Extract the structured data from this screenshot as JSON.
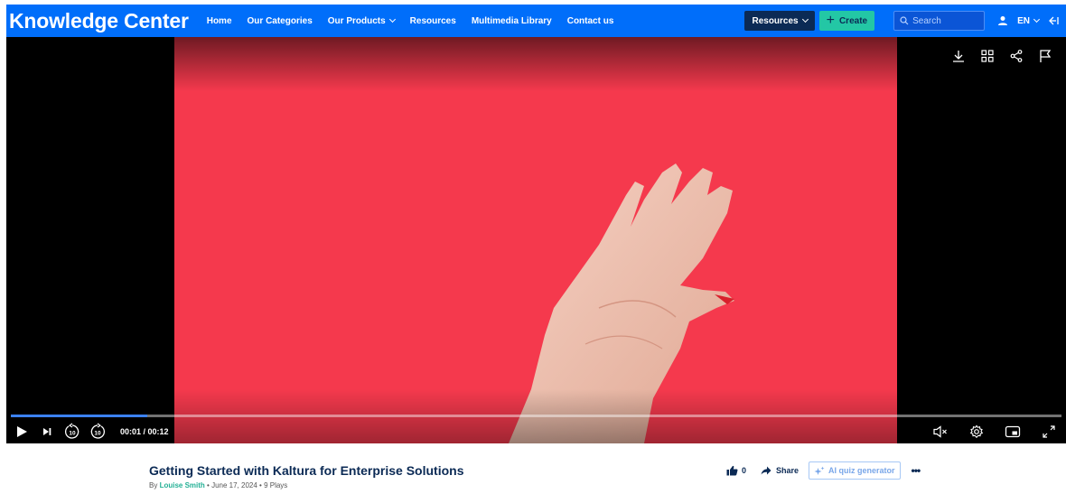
{
  "header": {
    "brand": "Knowledge Center",
    "nav": [
      {
        "label": "Home",
        "has_dropdown": false
      },
      {
        "label": "Our Categories",
        "has_dropdown": false
      },
      {
        "label": "Our Products",
        "has_dropdown": true
      },
      {
        "label": "Resources",
        "has_dropdown": false
      },
      {
        "label": "Multimedia Library",
        "has_dropdown": false
      },
      {
        "label": "Contact us",
        "has_dropdown": false
      }
    ],
    "resources_button": "Resources",
    "create_button": "Create",
    "search_placeholder": "Search",
    "language": "EN",
    "colors": {
      "bar": "#006efa",
      "resources_bg": "#0b2a55",
      "create_bg": "#23c7a5"
    }
  },
  "player": {
    "time_display": "00:01 / 00:12",
    "progress": 0.13,
    "video_bg": "#f5394d",
    "top_icons": [
      "download-icon",
      "grid-icon",
      "share-icon",
      "flag-icon"
    ],
    "bottom_left_icons": [
      "play-icon",
      "next-icon",
      "rewind-10-icon",
      "forward-10-icon"
    ],
    "bottom_right_icons": [
      "mute-icon",
      "settings-icon",
      "picture-in-picture-icon",
      "fullscreen-icon"
    ],
    "rewind_seconds": "10",
    "forward_seconds": "10"
  },
  "media": {
    "title": "Getting Started with Kaltura for Enterprise Solutions",
    "by": "By",
    "author": "Louise Smith",
    "date": "June 17, 2024",
    "plays": "9 Plays",
    "likes": "0",
    "share_label": "Share",
    "quiz_label": "AI quiz generator"
  }
}
